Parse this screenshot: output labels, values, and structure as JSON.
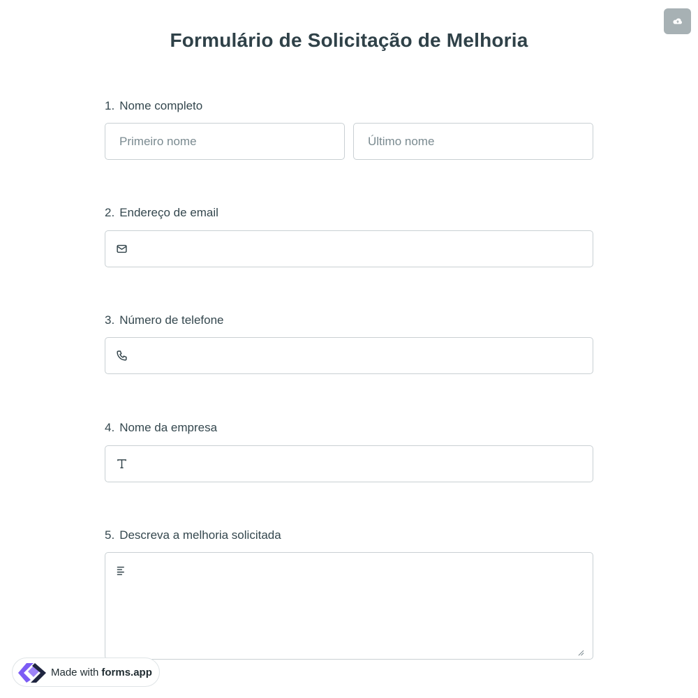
{
  "form": {
    "title": "Formulário de Solicitação de Melhoria"
  },
  "questions": [
    {
      "number": "1.",
      "label": "Nome completo",
      "first_placeholder": "Primeiro nome",
      "last_placeholder": "Último nome"
    },
    {
      "number": "2.",
      "label": "Endereço de email",
      "icon": "envelope-icon"
    },
    {
      "number": "3.",
      "label": "Número de telefone",
      "icon": "phone-icon"
    },
    {
      "number": "4.",
      "label": "Nome da empresa",
      "icon": "text-icon"
    },
    {
      "number": "5.",
      "label": "Descreva a melhoria solicitada",
      "icon": "align-left-icon"
    }
  ],
  "badge": {
    "made_with": "Made with",
    "brand": "forms.app"
  },
  "toolbar": {
    "save_icon": "cloud-upload-icon"
  },
  "colors": {
    "title": "#2f4148",
    "field_border": "#c9d0d3",
    "save_button_bg": "#a7b1b4",
    "logo_purple": "#7c5cf5",
    "logo_dark": "#1f2540"
  }
}
